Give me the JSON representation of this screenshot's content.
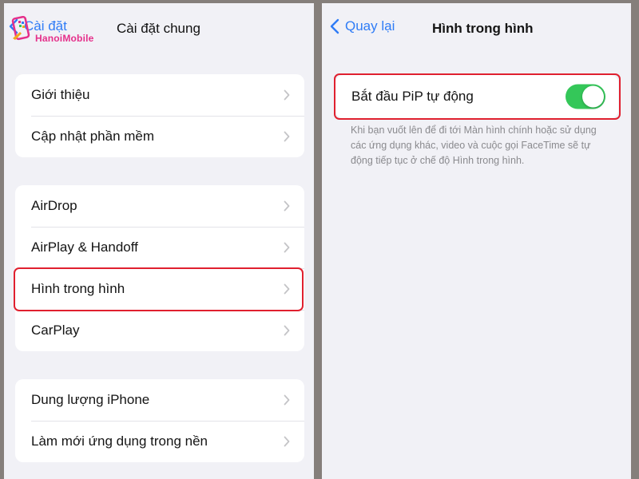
{
  "left": {
    "back_label": "Cài đặt",
    "title": "Cài đặt chung",
    "watermark": "HanoiMobile",
    "groups": [
      {
        "items": [
          {
            "label": "Giới thiệu"
          },
          {
            "label": "Cập nhật phần mềm"
          }
        ]
      },
      {
        "items": [
          {
            "label": "AirDrop"
          },
          {
            "label": "AirPlay & Handoff"
          },
          {
            "label": "Hình trong hình"
          },
          {
            "label": "CarPlay"
          }
        ]
      },
      {
        "items": [
          {
            "label": "Dung lượng iPhone"
          },
          {
            "label": "Làm mới ứng dụng trong nền"
          }
        ]
      }
    ],
    "highlighted_item": "Hình trong hình"
  },
  "right": {
    "back_label": "Quay lại",
    "title": "Hình trong hình",
    "toggle": {
      "label": "Bắt đầu PiP tự động",
      "state": "on"
    },
    "footnote": "Khi bạn vuốt lên để đi tới Màn hình chính hoặc sử dụng các ứng dụng khác, video và cuộc gọi FaceTime sẽ tự động tiếp tục ở chế độ Hình trong hình."
  },
  "colors": {
    "accent": "#2f7cf6",
    "toggle_on": "#34c759",
    "highlight": "#e0202f",
    "background": "#f1f1f6"
  }
}
